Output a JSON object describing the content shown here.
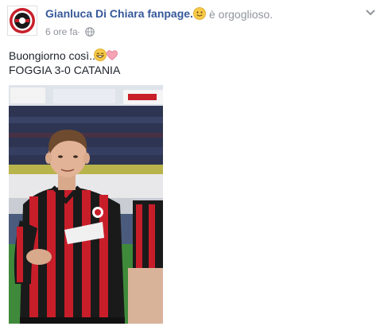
{
  "post": {
    "author": "Gianluca Di Chiara fanpage.",
    "feeling_emoji": "slightly-smiling-face",
    "feeling_text": "è orgoglioso.",
    "timestamp": "6 ore fa",
    "separator": "·",
    "privacy_icon": "globe-icon",
    "menu_icon": "chevron-down-icon",
    "text_line1": "Buongiorno così..",
    "text_line1_emojis": [
      "grinning-face",
      "pink-heart"
    ],
    "text_line2": "FOGGIA 3-0 CATANIA"
  },
  "colors": {
    "author_link": "#365899",
    "meta_gray": "#90949c",
    "body_text": "#1d2129",
    "jersey_red": "#c81e2a",
    "jersey_black": "#1a1a1a",
    "pitch_green": "#3f8a3a"
  }
}
